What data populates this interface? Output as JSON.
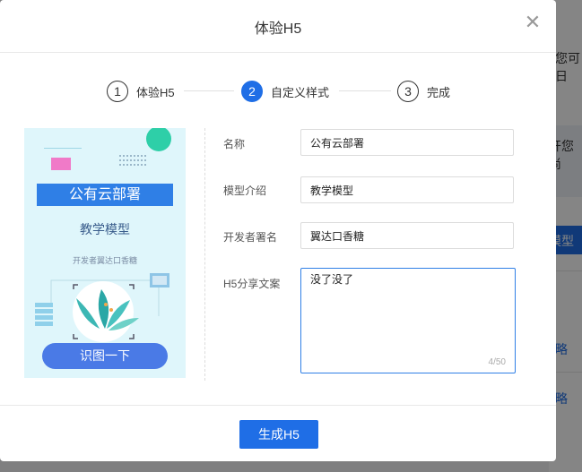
{
  "background": {
    "text_top": "您可日",
    "text_mid": "开您尚",
    "blue_button": "模型",
    "link_1": "略",
    "link_2": "略"
  },
  "modal": {
    "title": "体验H5",
    "close_icon": "close-icon",
    "steps": [
      {
        "number": "1",
        "label": "体验H5",
        "active": false
      },
      {
        "number": "2",
        "label": "自定义样式",
        "active": true
      },
      {
        "number": "3",
        "label": "完成",
        "active": false
      }
    ],
    "preview": {
      "title": "公有云部署",
      "subtitle": "教学模型",
      "author": "开发者翼达口香糖",
      "button": "识图一下"
    },
    "form": {
      "name_label": "名称",
      "name_value": "公有云部署",
      "intro_label": "模型介绍",
      "intro_value": "教学模型",
      "dev_label": "开发者署名",
      "dev_value": "翼达口香糖",
      "share_label": "H5分享文案",
      "share_value": "没了没了",
      "share_counter": "4/50"
    },
    "submit_button": "生成H5"
  },
  "colors": {
    "primary": "#1f6ee6",
    "preview_bg": "#dff6fb"
  }
}
